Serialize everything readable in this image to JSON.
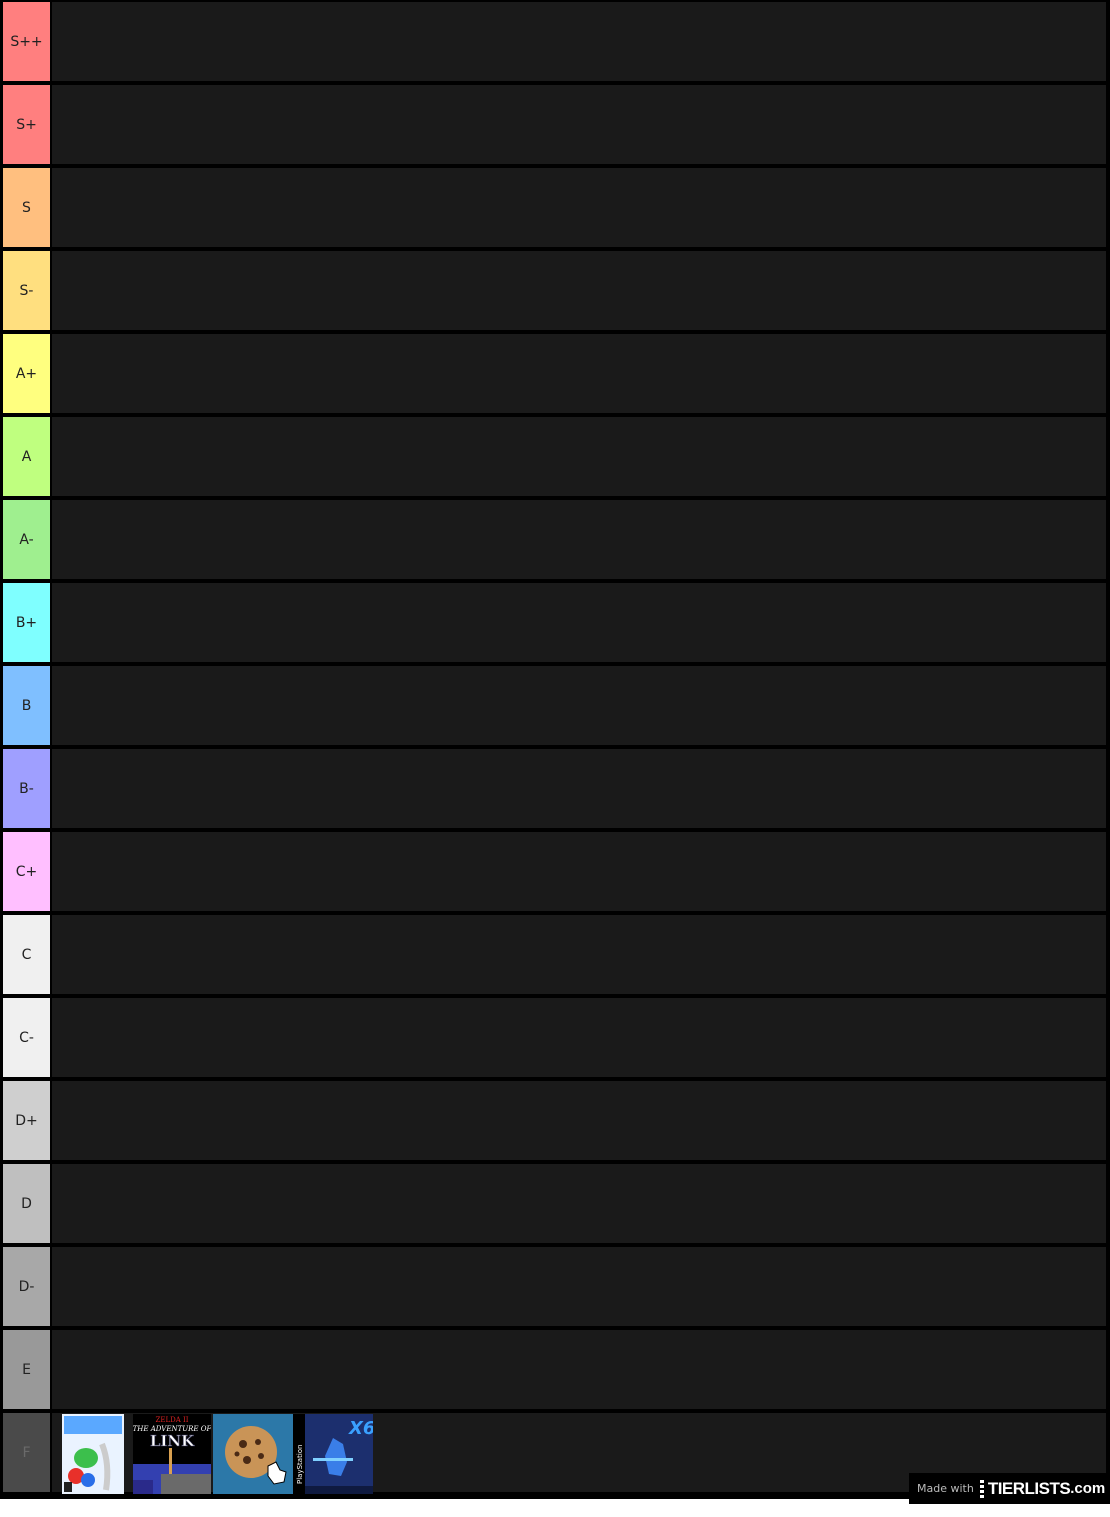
{
  "tiers": [
    {
      "label": "S++",
      "color": "#ff7f7f"
    },
    {
      "label": "S+",
      "color": "#ff7f7f"
    },
    {
      "label": "S",
      "color": "#ffbf7f"
    },
    {
      "label": "S-",
      "color": "#ffdf7f"
    },
    {
      "label": "A+",
      "color": "#ffff7f"
    },
    {
      "label": "A",
      "color": "#bfff7f"
    },
    {
      "label": "A-",
      "color": "#9fef8f"
    },
    {
      "label": "B+",
      "color": "#7fffff"
    },
    {
      "label": "B",
      "color": "#7fbfff"
    },
    {
      "label": "B-",
      "color": "#9f9fff"
    },
    {
      "label": "C+",
      "color": "#ffbfff"
    },
    {
      "label": "C",
      "color": "#f0f0f0"
    },
    {
      "label": "C-",
      "color": "#f0f0f0"
    },
    {
      "label": "D+",
      "color": "#cfcfcf"
    },
    {
      "label": "D",
      "color": "#bfbfbf"
    },
    {
      "label": "D-",
      "color": "#a8a8a8"
    },
    {
      "label": "E",
      "color": "#999999"
    },
    {
      "label": "F",
      "color": "#4a4a4a"
    }
  ],
  "f_items": [
    {
      "icon": "game-cover-bowling-icon"
    },
    {
      "icon": "game-cover-zelda-adventure-of-link-icon",
      "text": "THE ADVENTURE OF LINK"
    },
    {
      "icon": "cookie-clicker-icon"
    },
    {
      "icon": "game-cover-megaman-x6-icon",
      "text": "X6"
    }
  ],
  "watermark": {
    "made_with": "Made with",
    "brand": "TIERLISTS",
    "domain": ".com"
  }
}
